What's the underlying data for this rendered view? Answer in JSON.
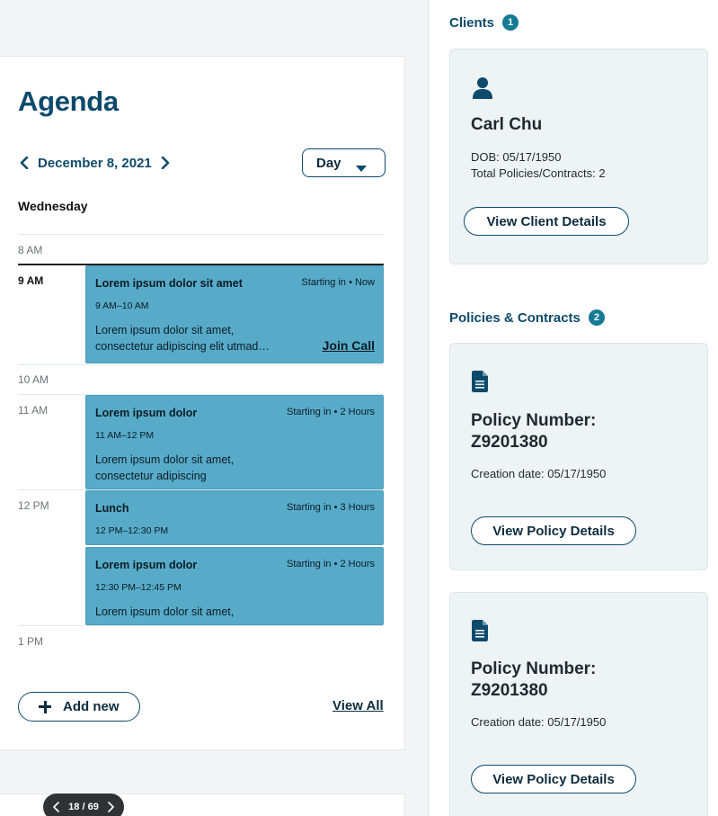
{
  "agenda": {
    "title": "Agenda",
    "date": "December 8, 2021",
    "view": "Day",
    "weekday": "Wednesday",
    "hours": [
      "8 AM",
      "9 AM",
      "10 AM",
      "11 AM",
      "12 PM",
      "1 PM"
    ],
    "events": [
      {
        "title": "Lorem ipsum dolor sit amet",
        "starting": "Starting in • Now",
        "time": "9 AM–10 AM",
        "desc_line1": "Lorem ipsum dolor sit amet,",
        "desc_line2": "consectetur adipiscing elit utmad…",
        "action": "Join Call"
      },
      {
        "title": "Lorem ipsum dolor",
        "starting": "Starting in • 2 Hours",
        "time": "11 AM–12 PM",
        "desc_line1": "Lorem ipsum dolor sit amet,",
        "desc_line2": "consectetur adipiscing"
      },
      {
        "title": "Lunch",
        "starting": "Starting in • 3 Hours",
        "time": "12 PM–12:30 PM"
      },
      {
        "title": "Lorem ipsum dolor",
        "starting": "Starting in • 2 Hours",
        "time": "12:30 PM–12:45 PM",
        "desc_line1": "Lorem ipsum dolor sit amet,"
      }
    ],
    "add_new": "Add new",
    "view_all": "View All"
  },
  "pager": {
    "text": "18 / 69"
  },
  "clients": {
    "heading": "Clients",
    "count": "1",
    "card": {
      "name": "Carl Chu",
      "dob": "DOB: 05/17/1950",
      "policies": "Total Policies/Contracts: 2",
      "button": "View Client Details"
    }
  },
  "policies": {
    "heading": "Policies & Contracts",
    "count": "2",
    "items": [
      {
        "number_label": "Policy Number:",
        "number": "Z9201380",
        "created": "Creation date: 05/17/1950",
        "button": "View Policy Details"
      },
      {
        "number_label": "Policy Number:",
        "number": "Z9201380",
        "created": "Creation date: 05/17/1950",
        "button": "View Policy Details"
      }
    ]
  },
  "colors": {
    "primary": "#0d4a6b",
    "event_bg": "#57abc9",
    "badge_bg": "#167a94",
    "card_bg": "#eef3f6"
  },
  "icons": [
    "chevron-left-icon",
    "chevron-right-icon",
    "caret-down-icon",
    "plus-icon",
    "person-icon",
    "document-icon"
  ]
}
